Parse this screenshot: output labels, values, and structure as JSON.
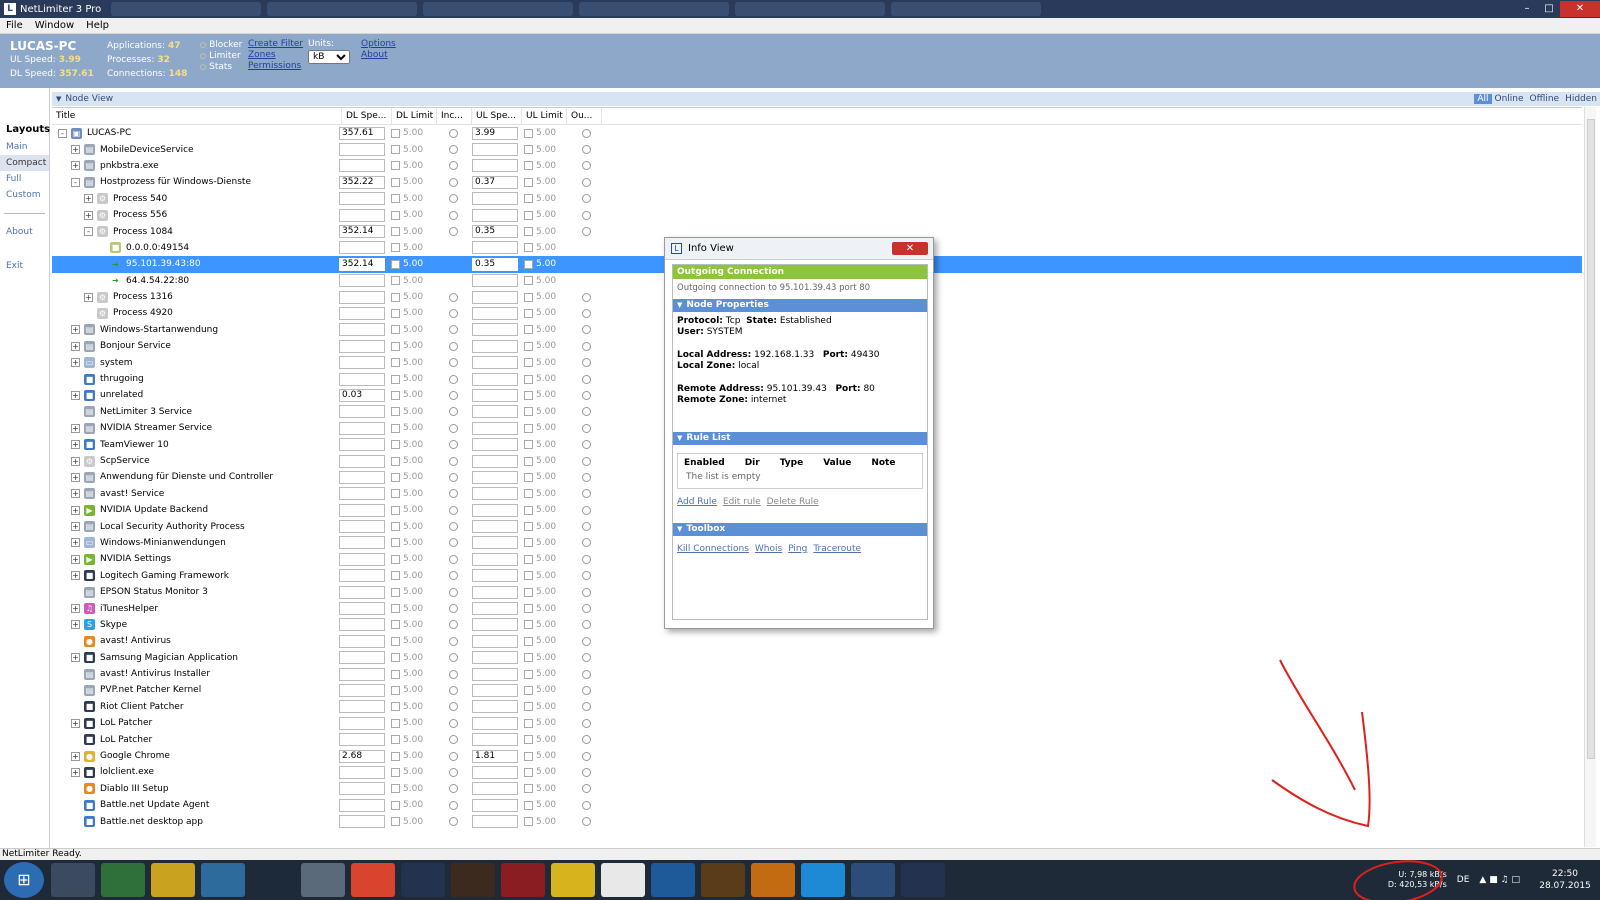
{
  "window": {
    "title": "NetLimiter 3 Pro"
  },
  "menu": [
    "File",
    "Window",
    "Help"
  ],
  "header": {
    "pc_name": "LUCAS-PC",
    "ul_speed_label": "UL Speed:",
    "ul_speed_value": "3.99",
    "dl_speed_label": "DL Speed:",
    "dl_speed_value": "357.61",
    "applications_label": "Applications:",
    "applications_value": "47",
    "processes_label": "Processes:",
    "processes_value": "32",
    "connections_label": "Connections:",
    "connections_value": "148",
    "options": [
      "Blocker",
      "Limiter",
      "Stats"
    ],
    "links_a": [
      "Create Filter",
      "Zones",
      "Permissions"
    ],
    "units_label": "Units:",
    "units_value": "kB",
    "links_b": [
      "Options",
      "About"
    ]
  },
  "sidebar": {
    "caption": "Layouts",
    "items": [
      "Main",
      "Compact",
      "Full",
      "Custom"
    ],
    "about": "About",
    "exit": "Exit"
  },
  "node_view": {
    "title": "Node View",
    "filters": [
      "All",
      "Online",
      "Offline",
      "Hidden"
    ],
    "columns": [
      "Title",
      "DL Spe...",
      "DL Limit",
      "Inc...",
      "UL Spe...",
      "UL Limit",
      "Ou..."
    ],
    "rows": [
      {
        "title": "LUCAS-PC",
        "level": 0,
        "exp": "-",
        "icon": "computer",
        "dl": "357.61",
        "dl_limit": "5.00",
        "ul": "3.99",
        "ul_limit": "5.00",
        "radios": true
      },
      {
        "title": "MobileDeviceService",
        "level": 1,
        "exp": "+",
        "icon": "app",
        "dl": "",
        "dl_limit": "5.00",
        "ul": "",
        "ul_limit": "5.00",
        "radios": true
      },
      {
        "title": "pnkbstra.exe",
        "level": 1,
        "exp": "+",
        "icon": "app",
        "dl": "",
        "dl_limit": "5.00",
        "ul": "",
        "ul_limit": "5.00",
        "radios": true
      },
      {
        "title": "Hostprozess für Windows-Dienste",
        "level": 1,
        "exp": "-",
        "icon": "app",
        "dl": "352.22",
        "dl_limit": "5.00",
        "ul": "0.37",
        "ul_limit": "5.00",
        "radios": true
      },
      {
        "title": "Process 540",
        "level": 2,
        "exp": "+",
        "icon": "gear",
        "dl": "",
        "dl_limit": "5.00",
        "ul": "",
        "ul_limit": "5.00",
        "radios": true
      },
      {
        "title": "Process 556",
        "level": 2,
        "exp": "+",
        "icon": "gear",
        "dl": "",
        "dl_limit": "5.00",
        "ul": "",
        "ul_limit": "5.00",
        "radios": true
      },
      {
        "title": "Process 1084",
        "level": 2,
        "exp": "-",
        "icon": "gear",
        "dl": "352.14",
        "dl_limit": "5.00",
        "ul": "0.35",
        "ul_limit": "5.00",
        "radios": true
      },
      {
        "title": "0.0.0.0:49154",
        "level": 3,
        "exp": "",
        "icon": "listen",
        "dl": "",
        "dl_limit": "5.00",
        "ul": "",
        "ul_limit": "5.00",
        "radios": false
      },
      {
        "title": "95.101.39.43:80",
        "level": 3,
        "exp": "",
        "icon": "arrow",
        "dl": "352.14",
        "dl_limit": "5.00",
        "ul": "0.35",
        "ul_limit": "5.00",
        "radios": false,
        "selected": true
      },
      {
        "title": "64.4.54.22:80",
        "level": 3,
        "exp": "",
        "icon": "arrow",
        "dl": "",
        "dl_limit": "5.00",
        "ul": "",
        "ul_limit": "5.00",
        "radios": false
      },
      {
        "title": "Process 1316",
        "level": 2,
        "exp": "+",
        "icon": "gear",
        "dl": "",
        "dl_limit": "5.00",
        "ul": "",
        "ul_limit": "5.00",
        "radios": true
      },
      {
        "title": "Process 4920",
        "level": 2,
        "exp": "",
        "icon": "gear",
        "dl": "",
        "dl_limit": "5.00",
        "ul": "",
        "ul_limit": "5.00",
        "radios": true
      },
      {
        "title": "Windows-Startanwendung",
        "level": 1,
        "exp": "+",
        "icon": "app",
        "dl": "",
        "dl_limit": "5.00",
        "ul": "",
        "ul_limit": "5.00",
        "radios": true
      },
      {
        "title": "Bonjour Service",
        "level": 1,
        "exp": "+",
        "icon": "app",
        "dl": "",
        "dl_limit": "5.00",
        "ul": "",
        "ul_limit": "5.00",
        "radios": true
      },
      {
        "title": "system",
        "level": 1,
        "exp": "+",
        "icon": "window",
        "dl": "",
        "dl_limit": "5.00",
        "ul": "",
        "ul_limit": "5.00",
        "radios": true
      },
      {
        "title": "thrugoing",
        "level": 1,
        "exp": "",
        "icon": "blue",
        "dl": "",
        "dl_limit": "5.00",
        "ul": "",
        "ul_limit": "5.00",
        "radios": true
      },
      {
        "title": "unrelated",
        "level": 1,
        "exp": "+",
        "icon": "blue",
        "dl": "0.03",
        "dl_limit": "5.00",
        "ul": "",
        "ul_limit": "5.00",
        "radios": true
      },
      {
        "title": "NetLimiter 3 Service",
        "level": 1,
        "exp": "",
        "icon": "app",
        "dl": "",
        "dl_limit": "5.00",
        "ul": "",
        "ul_limit": "5.00",
        "radios": true
      },
      {
        "title": "NVIDIA Streamer Service",
        "level": 1,
        "exp": "+",
        "icon": "app",
        "dl": "",
        "dl_limit": "5.00",
        "ul": "",
        "ul_limit": "5.00",
        "radios": true
      },
      {
        "title": "TeamViewer 10",
        "level": 1,
        "exp": "+",
        "icon": "blue",
        "dl": "",
        "dl_limit": "5.00",
        "ul": "",
        "ul_limit": "5.00",
        "radios": true
      },
      {
        "title": "ScpService",
        "level": 1,
        "exp": "+",
        "icon": "gear",
        "dl": "",
        "dl_limit": "5.00",
        "ul": "",
        "ul_limit": "5.00",
        "radios": true
      },
      {
        "title": "Anwendung für Dienste und Controller",
        "level": 1,
        "exp": "+",
        "icon": "app",
        "dl": "",
        "dl_limit": "5.00",
        "ul": "",
        "ul_limit": "5.00",
        "radios": true
      },
      {
        "title": "avast! Service",
        "level": 1,
        "exp": "+",
        "icon": "app",
        "dl": "",
        "dl_limit": "5.00",
        "ul": "",
        "ul_limit": "5.00",
        "radios": true
      },
      {
        "title": "NVIDIA Update Backend",
        "level": 1,
        "exp": "+",
        "icon": "green",
        "dl": "",
        "dl_limit": "5.00",
        "ul": "",
        "ul_limit": "5.00",
        "radios": true
      },
      {
        "title": "Local Security Authority Process",
        "level": 1,
        "exp": "+",
        "icon": "app",
        "dl": "",
        "dl_limit": "5.00",
        "ul": "",
        "ul_limit": "5.00",
        "radios": true
      },
      {
        "title": "Windows-Minianwendungen",
        "level": 1,
        "exp": "+",
        "icon": "window",
        "dl": "",
        "dl_limit": "5.00",
        "ul": "",
        "ul_limit": "5.00",
        "radios": true
      },
      {
        "title": "NVIDIA Settings",
        "level": 1,
        "exp": "+",
        "icon": "green",
        "dl": "",
        "dl_limit": "5.00",
        "ul": "",
        "ul_limit": "5.00",
        "radios": true
      },
      {
        "title": "Logitech Gaming Framework",
        "level": 1,
        "exp": "+",
        "icon": "dark",
        "dl": "",
        "dl_limit": "5.00",
        "ul": "",
        "ul_limit": "5.00",
        "radios": true
      },
      {
        "title": "EPSON Status Monitor 3",
        "level": 1,
        "exp": "",
        "icon": "app",
        "dl": "",
        "dl_limit": "5.00",
        "ul": "",
        "ul_limit": "5.00",
        "radios": true
      },
      {
        "title": "iTunesHelper",
        "level": 1,
        "exp": "+",
        "icon": "pink",
        "dl": "",
        "dl_limit": "5.00",
        "ul": "",
        "ul_limit": "5.00",
        "radios": true
      },
      {
        "title": "Skype",
        "level": 1,
        "exp": "+",
        "icon": "skype",
        "dl": "",
        "dl_limit": "5.00",
        "ul": "",
        "ul_limit": "5.00",
        "radios": true
      },
      {
        "title": "avast! Antivirus",
        "level": 1,
        "exp": "",
        "icon": "orange",
        "dl": "",
        "dl_limit": "5.00",
        "ul": "",
        "ul_limit": "5.00",
        "radios": true
      },
      {
        "title": "Samsung Magician Application",
        "level": 1,
        "exp": "+",
        "icon": "dark",
        "dl": "",
        "dl_limit": "5.00",
        "ul": "",
        "ul_limit": "5.00",
        "radios": true
      },
      {
        "title": "avast! Antivirus Installer",
        "level": 1,
        "exp": "",
        "icon": "app",
        "dl": "",
        "dl_limit": "5.00",
        "ul": "",
        "ul_limit": "5.00",
        "radios": true
      },
      {
        "title": "PVP.net Patcher Kernel",
        "level": 1,
        "exp": "",
        "icon": "app",
        "dl": "",
        "dl_limit": "5.00",
        "ul": "",
        "ul_limit": "5.00",
        "radios": true
      },
      {
        "title": "Riot Client Patcher",
        "level": 1,
        "exp": "",
        "icon": "dark",
        "dl": "",
        "dl_limit": "5.00",
        "ul": "",
        "ul_limit": "5.00",
        "radios": true
      },
      {
        "title": "LoL Patcher",
        "level": 1,
        "exp": "+",
        "icon": "dark",
        "dl": "",
        "dl_limit": "5.00",
        "ul": "",
        "ul_limit": "5.00",
        "radios": true
      },
      {
        "title": "LoL Patcher",
        "level": 1,
        "exp": "",
        "icon": "dark",
        "dl": "",
        "dl_limit": "5.00",
        "ul": "",
        "ul_limit": "5.00",
        "radios": true
      },
      {
        "title": "Google Chrome",
        "level": 1,
        "exp": "+",
        "icon": "chrome",
        "dl": "2.68",
        "dl_limit": "5.00",
        "ul": "1.81",
        "ul_limit": "5.00",
        "radios": true
      },
      {
        "title": "lolclient.exe",
        "level": 1,
        "exp": "+",
        "icon": "dark",
        "dl": "",
        "dl_limit": "5.00",
        "ul": "",
        "ul_limit": "5.00",
        "radios": true
      },
      {
        "title": "Diablo III Setup",
        "level": 1,
        "exp": "",
        "icon": "orange",
        "dl": "",
        "dl_limit": "5.00",
        "ul": "",
        "ul_limit": "5.00",
        "radios": true
      },
      {
        "title": "Battle.net Update Agent",
        "level": 1,
        "exp": "",
        "icon": "blue",
        "dl": "",
        "dl_limit": "5.00",
        "ul": "",
        "ul_limit": "5.00",
        "radios": true
      },
      {
        "title": "Battle.net desktop app",
        "level": 1,
        "exp": "",
        "icon": "blue",
        "dl": "",
        "dl_limit": "5.00",
        "ul": "",
        "ul_limit": "5.00",
        "radios": true
      }
    ]
  },
  "info_view": {
    "title": "Info View",
    "banner": "Outgoing Connection",
    "subtitle": "Outgoing connection to 95.101.39.43 port 80",
    "node_props_title": "Node Properties",
    "protocol_label": "Protocol:",
    "protocol_value": "Tcp",
    "state_label": "State:",
    "state_value": "Established",
    "user_label": "User:",
    "user_value": "SYSTEM",
    "local_addr_label": "Local Address:",
    "local_addr_value": "192.168.1.33",
    "local_port_label": "Port:",
    "local_port_value": "49430",
    "local_zone_label": "Local Zone:",
    "local_zone_value": "local",
    "remote_addr_label": "Remote Address:",
    "remote_addr_value": "95.101.39.43",
    "remote_port_label": "Port:",
    "remote_port_value": "80",
    "remote_zone_label": "Remote Zone:",
    "remote_zone_value": "internet",
    "rule_list_title": "Rule List",
    "rule_columns": [
      "Enabled",
      "Dir",
      "Type",
      "Value",
      "Note"
    ],
    "rule_empty": "The list is empty",
    "rule_actions": [
      "Add Rule",
      "Edit rule",
      "Delete Rule"
    ],
    "toolbox_title": "Toolbox",
    "tools": [
      "Kill Connections",
      "Whois",
      "Ping",
      "Traceroute"
    ]
  },
  "status_bar": {
    "text": "NetLimiter Ready."
  },
  "taskbar": {
    "ul_label": "U:",
    "ul_value": "7,98 kB/s",
    "dl_label": "D:",
    "dl_value": "420,53 kB/s",
    "lang": "DE",
    "time": "22:50",
    "date": "28.07.2015",
    "apps": [
      "steam",
      "explorer",
      "folder",
      "earth",
      "app",
      "media",
      "chrome",
      "netlimiter-l",
      "game",
      "red-app",
      "fifa-15",
      "itunes",
      "crossed-swords",
      "target",
      "diablo",
      "skype",
      "netlimiter",
      "lol"
    ]
  },
  "colors": {
    "accent": "#8ea8c9",
    "selection": "#3d95ff",
    "banner_green": "#8cc43e",
    "section_blue": "#5b8fd6",
    "annotation_red": "#e0201a"
  }
}
